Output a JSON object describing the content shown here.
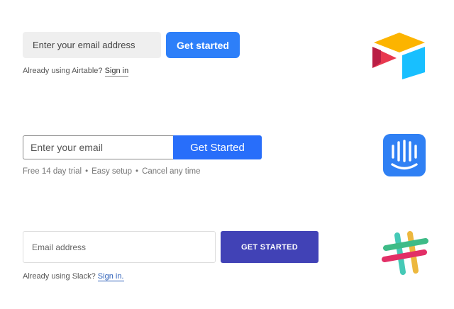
{
  "airtable": {
    "email_placeholder": "Enter your email address",
    "cta_label": "Get started",
    "signin_prompt": "Already using Airtable?",
    "signin_link": "Sign in",
    "logo_icon": "airtable-logo-icon",
    "colors": {
      "button": "#2d7ff9",
      "input_bg": "#efefef",
      "logo_yellow": "#fcb400",
      "logo_blue": "#18bfff",
      "logo_red": "#e8384f"
    }
  },
  "intercom": {
    "email_placeholder": "Enter your email",
    "cta_label": "Get Started",
    "features": [
      "Free 14 day trial",
      "Easy setup",
      "Cancel any time"
    ],
    "separator": "•",
    "logo_icon": "intercom-logo-icon",
    "colors": {
      "button": "#286efa",
      "logo": "#2f80f4"
    }
  },
  "slack": {
    "email_placeholder": "Email address",
    "cta_label": "GET STARTED",
    "signin_prompt": "Already using Slack?",
    "signin_link": "Sign in.",
    "logo_icon": "slack-logo-icon",
    "colors": {
      "button": "#4142b6",
      "link": "#2c5fb8",
      "logo_teal": "#36c5b0",
      "logo_green": "#2eb67d",
      "logo_yellow": "#ecb22e",
      "logo_pink": "#e01e5a"
    }
  }
}
